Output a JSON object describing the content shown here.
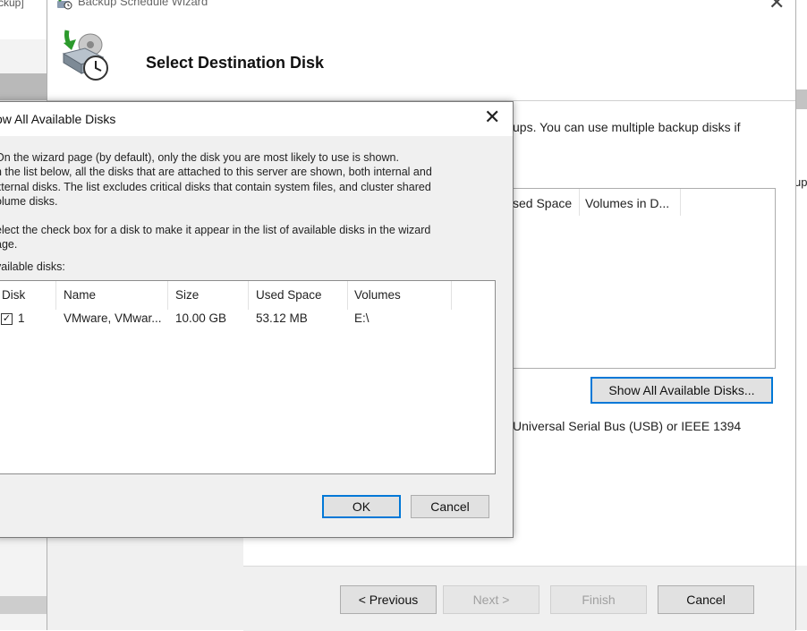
{
  "background": {
    "left_text": "ckup]",
    "right_text": "up"
  },
  "wizard": {
    "title": "Backup Schedule Wizard",
    "heading": "Select Destination Disk",
    "description": "ups. You can use multiple backup disks if",
    "list_columns": [
      "sed Space",
      "Volumes in D..."
    ],
    "show_all_button": "Show All Available Disks...",
    "usb_text": "Universal Serial Bus (USB) or IEEE 1394",
    "buttons": {
      "previous": "< Previous",
      "next": "Next >",
      "finish": "Finish",
      "cancel": "Cancel"
    }
  },
  "dialog": {
    "title": "ow All Available Disks",
    "para1": [
      "On the wizard page (by default), only the disk you are most likely to use is shown.",
      "n the list below, all the disks that are attached to this server are shown, both internal and",
      "xternal disks. The list excludes critical disks that contain system files, and cluster shared",
      "olume disks."
    ],
    "para2": [
      "elect the check box for a disk to make it appear in the list of available disks in the wizard",
      "age."
    ],
    "available_label": "vailable disks:",
    "columns": {
      "disk": "Disk",
      "name": "Name",
      "size": "Size",
      "used_space": "Used Space",
      "volumes": "Volumes"
    },
    "rows": [
      {
        "checked": true,
        "disk": "1",
        "name": "VMware, VMwar...",
        "size": "10.00 GB",
        "used_space": "53.12 MB",
        "volumes": "E:\\"
      }
    ],
    "ok_label": "OK",
    "cancel_label": "Cancel"
  },
  "colors": {
    "accent_blue": "#0078d7",
    "button_face": "#e1e1e1",
    "dialog_face": "#f0f0f0"
  }
}
